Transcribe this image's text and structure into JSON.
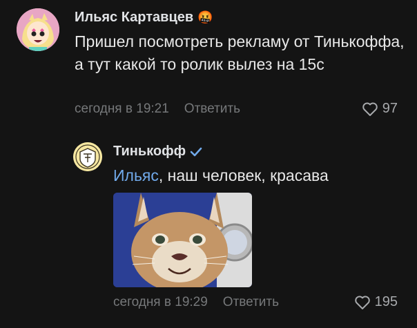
{
  "comment": {
    "author": "Ильяс Картавцев",
    "author_emoji": "🤬",
    "text": "Пришел посмотреть рекламу от Тинькоффа, а тут какой то ролик вылез на 15с",
    "time": "сегодня в 19:21",
    "reply_label": "Ответить",
    "likes": "97"
  },
  "reply": {
    "author": "Тинькофф",
    "mention": "Ильяс",
    "text": ", наш человек, красава",
    "time": "сегодня в 19:29",
    "reply_label": "Ответить",
    "likes": "195"
  },
  "colors": {
    "background": "#141414",
    "link": "#71aaeb",
    "verified": "#71aaeb",
    "secondary_text": "#76787a"
  }
}
